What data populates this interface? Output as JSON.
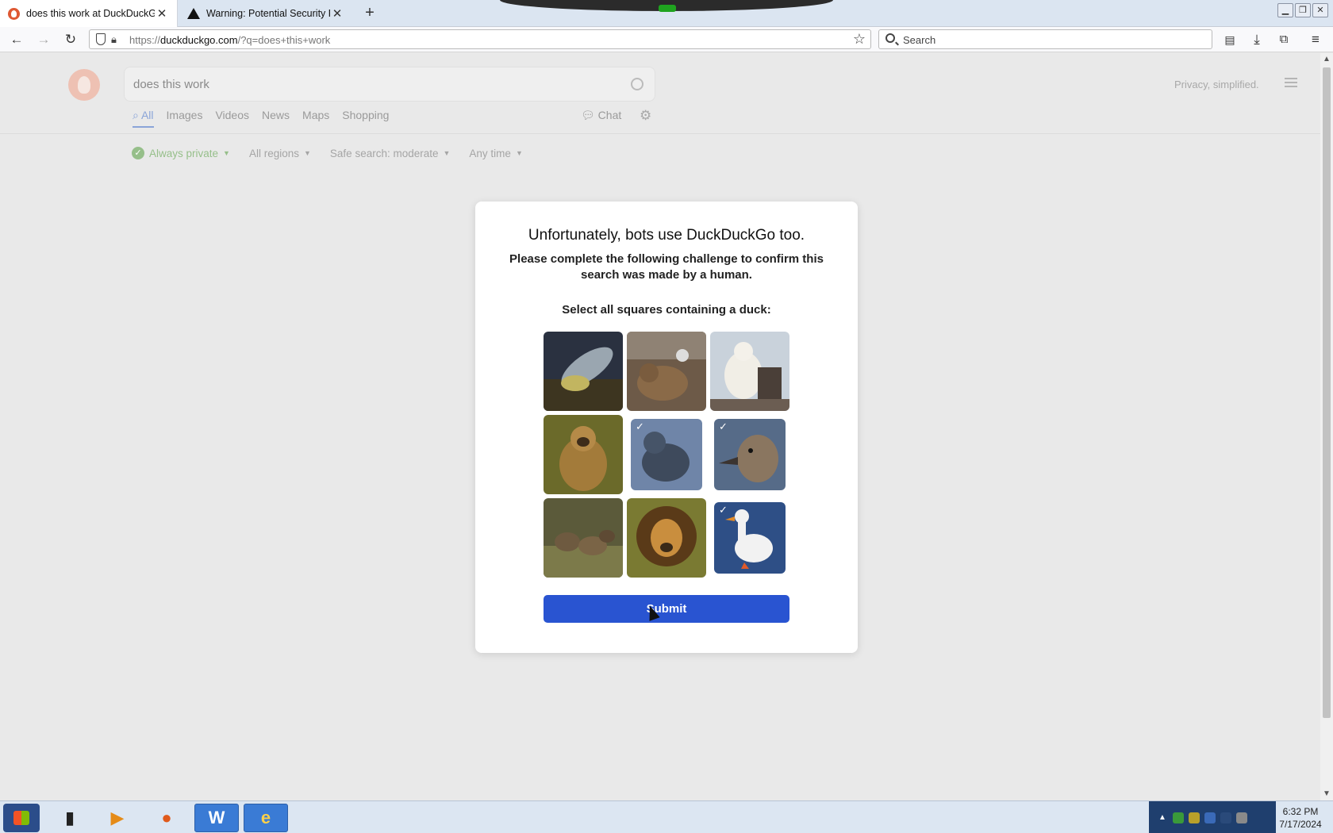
{
  "browser": {
    "tabs": [
      {
        "title": "does this work at DuckDuckGo",
        "active": true
      },
      {
        "title": "Warning: Potential Security Risk",
        "active": false
      }
    ],
    "new_tab_label": "+",
    "url_prefix": "https://",
    "url_host": "duckduckgo.com",
    "url_path": "/?q=does+this+work",
    "search_placeholder": "Search"
  },
  "ddg": {
    "query": "does this work",
    "tagline": "Privacy, simplified.",
    "tabs": [
      "All",
      "Images",
      "Videos",
      "News",
      "Maps",
      "Shopping"
    ],
    "chat_label": "Chat",
    "filters": {
      "private": "Always private",
      "regions": "All regions",
      "safe_search": "Safe search: moderate",
      "time": "Any time"
    }
  },
  "challenge": {
    "title": "Unfortunately, bots use DuckDuckGo too.",
    "subtitle": "Please complete the following challenge to confirm this search was made by a human.",
    "prompt": "Select all squares containing a duck:",
    "tiles": [
      {
        "subject": "fish",
        "selected": false
      },
      {
        "subject": "bear",
        "selected": false
      },
      {
        "subject": "polar-bear",
        "selected": false
      },
      {
        "subject": "monkey",
        "selected": false
      },
      {
        "subject": "seal",
        "selected": false
      },
      {
        "subject": "duck",
        "selected": true
      },
      {
        "subject": "ducklings",
        "selected": false
      },
      {
        "subject": "lion",
        "selected": false
      },
      {
        "subject": "white-duck",
        "selected": true
      }
    ],
    "submit_label": "Submit"
  },
  "taskbar": {
    "time": "6:32 PM",
    "date": "7/17/2024"
  },
  "colors": {
    "submit": "#2954d1",
    "ddg_orange": "#de5833",
    "page_dim": "#e9e9e9"
  }
}
